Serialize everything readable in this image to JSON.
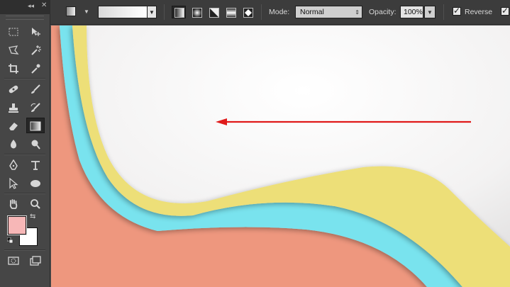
{
  "toolbar": {
    "mode_label": "Mode:",
    "mode_value": "Normal",
    "opacity_label": "Opacity:",
    "opacity_value": "100%",
    "reverse_label": "Reverse",
    "reverse_checked": true,
    "gradient_types": [
      "linear",
      "radial",
      "angle",
      "reflected",
      "diamond"
    ],
    "active_gradient_type": "linear"
  },
  "tools_panel": {
    "collapse_glyph": "◂◂",
    "close_glyph": "✕",
    "tools": [
      "rectangular-marquee",
      "move",
      "lasso",
      "magic-wand",
      "crop",
      "eyedropper",
      "spot-healing",
      "brush",
      "clone-stamp",
      "history-brush",
      "eraser",
      "gradient",
      "blur",
      "dodge",
      "pen",
      "type",
      "path-selection",
      "ellipse",
      "hand",
      "zoom"
    ],
    "active_tool": "gradient",
    "foreground_color": "#f7b7b7",
    "background_color": "#ffffff"
  },
  "canvas": {
    "colors": {
      "background": "#f4f3f3",
      "salmon": "#ee977e",
      "cyan": "#79e3ee",
      "yellow": "#eddf78",
      "arrow": "#e01a1a"
    }
  }
}
